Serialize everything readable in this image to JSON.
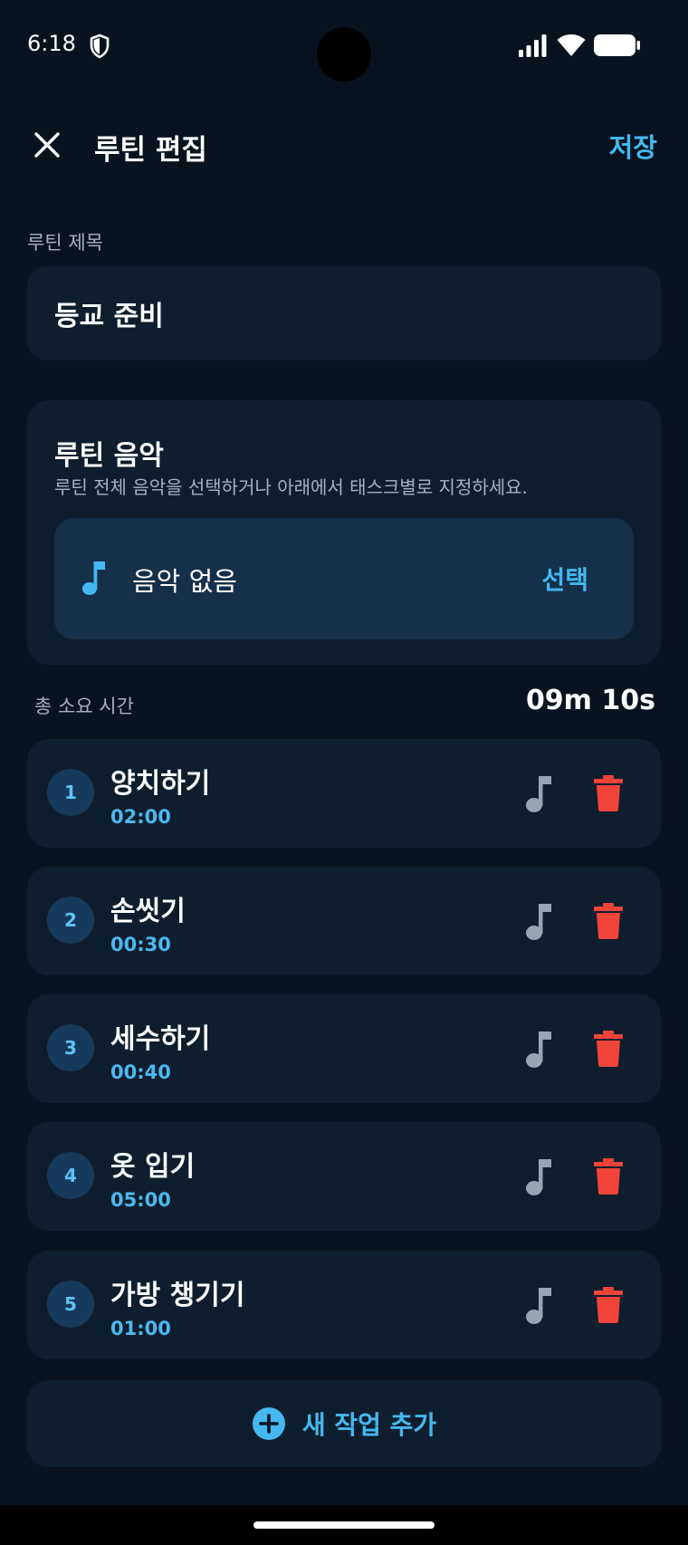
{
  "status_bar": {
    "time": "6:18"
  },
  "app_bar": {
    "title": "루틴 편집",
    "save_label": "저장"
  },
  "routine_title": {
    "label": "루틴 제목",
    "value": "등교 준비"
  },
  "routine_music": {
    "title": "루틴 음악",
    "description": "루틴 전체 음악을 선택하거나 아래에서 태스크별로 지정하세요.",
    "current": "음악 없음",
    "select_label": "선택"
  },
  "total": {
    "label": "총 소요 시간",
    "value": "09m 10s"
  },
  "tasks": [
    {
      "number": "1",
      "name": "양치하기",
      "duration": "02:00"
    },
    {
      "number": "2",
      "name": "손씻기",
      "duration": "00:30"
    },
    {
      "number": "3",
      "name": "세수하기",
      "duration": "00:40"
    },
    {
      "number": "4",
      "name": "옷 입기",
      "duration": "05:00"
    },
    {
      "number": "5",
      "name": "가방 챙기기",
      "duration": "01:00"
    }
  ],
  "add_task": {
    "label": "새 작업 추가"
  },
  "colors": {
    "background": "#08131f",
    "card": "#0f1e2e",
    "accent": "#45b8f0",
    "delete": "#f04438"
  },
  "icons": [
    "close-icon",
    "music-note-icon",
    "trash-icon",
    "plus-circle-icon",
    "shield-icon",
    "signal-icon",
    "wifi-icon",
    "battery-icon"
  ]
}
